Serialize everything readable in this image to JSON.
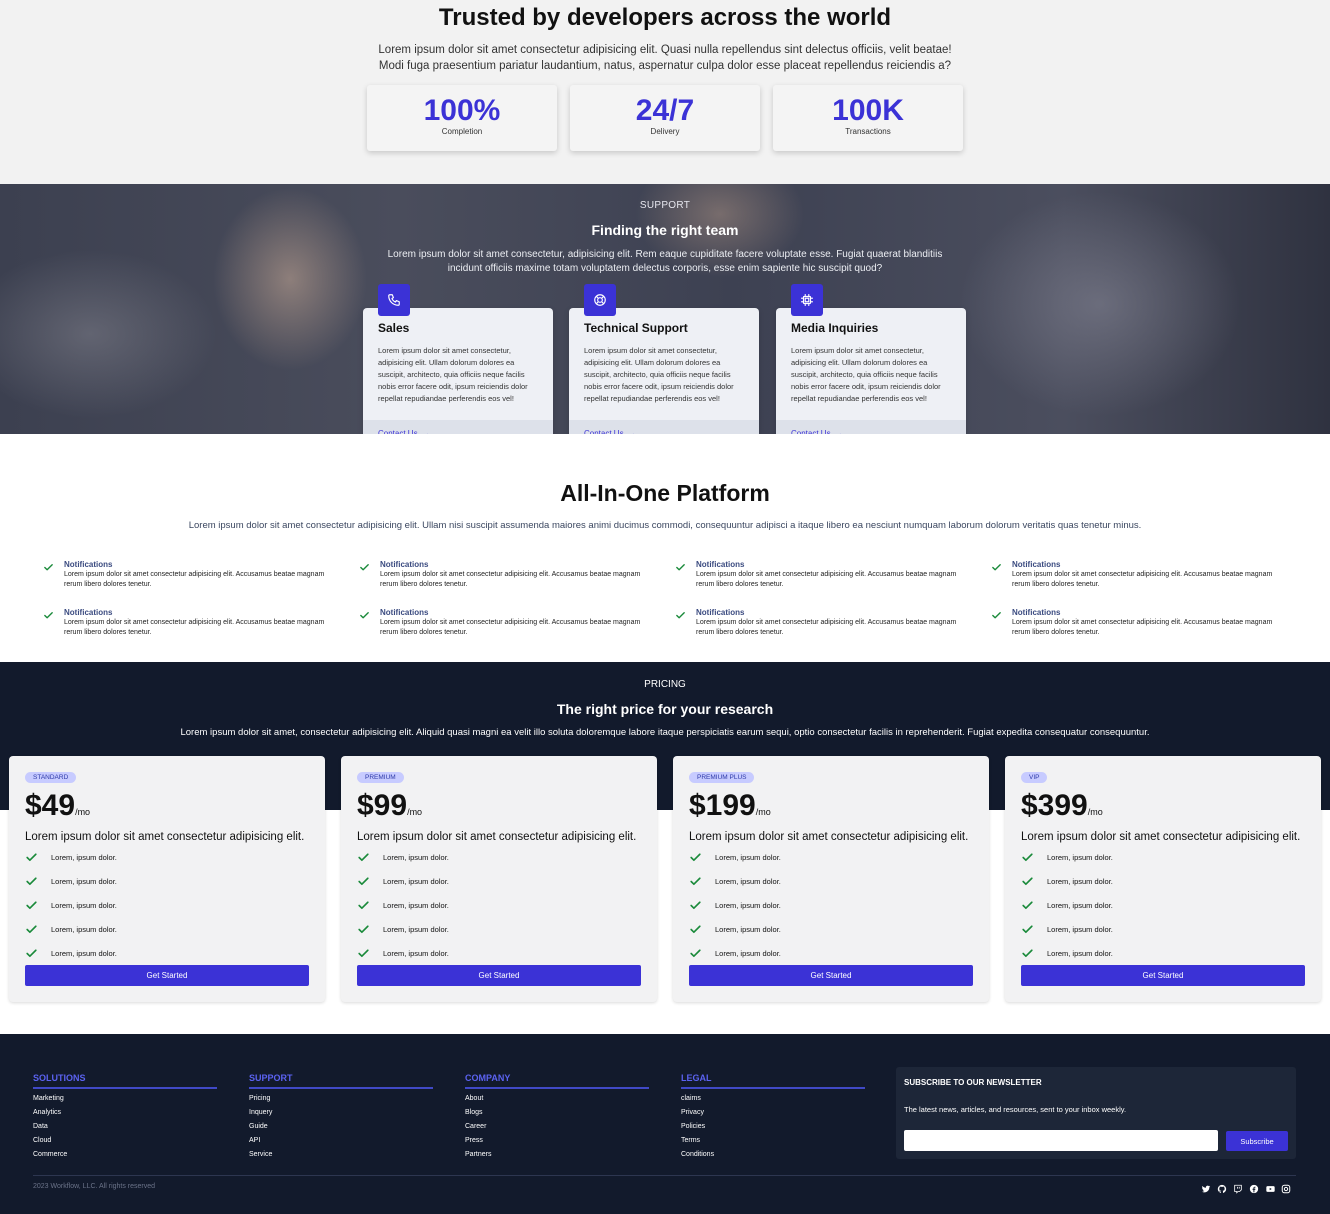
{
  "stats": {
    "title": "Trusted by developers across the world",
    "description": "Lorem ipsum dolor sit amet consectetur adipisicing elit. Quasi nulla repellendus sint delectus officiis, velit beatae! Modi fuga praesentium pariatur laudantium, natus, aspernatur culpa dolor esse placeat repellendus reiciendis a?",
    "items": [
      {
        "value": "100%",
        "label": "Completion"
      },
      {
        "value": "24/7",
        "label": "Delivery"
      },
      {
        "value": "100K",
        "label": "Transactions"
      }
    ]
  },
  "support": {
    "eyebrow": "SUPPORT",
    "title": "Finding the right team",
    "description": "Lorem ipsum dolor sit amet consectetur, adipisicing elit. Rem eaque cupiditate facere voluptate esse. Fugiat quaerat blanditiis incidunt officiis maxime totam voluptatem delectus corporis, esse enim sapiente hic suscipit quod?",
    "cards": [
      {
        "icon": "phone-icon",
        "title": "Sales",
        "text": "Lorem ipsum dolor sit amet consectetur, adipisicing elit. Ullam dolorum dolores ea suscipit, architecto, quia officiis neque facilis nobis error facere odit, ipsum reiciendis dolor repellat repudiandae perferendis eos vel!",
        "link": "Contact Us"
      },
      {
        "icon": "support-icon",
        "title": "Technical Support",
        "text": "Lorem ipsum dolor sit amet consectetur, adipisicing elit. Ullam dolorum dolores ea suscipit, architecto, quia officiis neque facilis nobis error facere odit, ipsum reiciendis dolor repellat repudiandae perferendis eos vel!",
        "link": "Contact Us"
      },
      {
        "icon": "chip-icon",
        "title": "Media Inquiries",
        "text": "Lorem ipsum dolor sit amet consectetur, adipisicing elit. Ullam dolorum dolores ea suscipit, architecto, quia officiis neque facilis nobis error facere odit, ipsum reiciendis dolor repellat repudiandae perferendis eos vel!",
        "link": "Contact Us"
      }
    ]
  },
  "platform": {
    "title": "All-In-One Platform",
    "description": "Lorem ipsum dolor sit amet consectetur adipisicing elit. Ullam nisi suscipit assumenda maiores animi ducimus commodi, consequuntur adipisci a itaque libero ea nesciunt numquam laborum dolorum veritatis quas tenetur minus.",
    "features": [
      {
        "title": "Notifications",
        "text": "Lorem ipsum dolor sit amet consectetur adipisicing elit. Accusamus beatae magnam rerum libero dolores tenetur."
      },
      {
        "title": "Notifications",
        "text": "Lorem ipsum dolor sit amet consectetur adipisicing elit. Accusamus beatae magnam rerum libero dolores tenetur."
      },
      {
        "title": "Notifications",
        "text": "Lorem ipsum dolor sit amet consectetur adipisicing elit. Accusamus beatae magnam rerum libero dolores tenetur."
      },
      {
        "title": "Notifications",
        "text": "Lorem ipsum dolor sit amet consectetur adipisicing elit. Accusamus beatae magnam rerum libero dolores tenetur."
      },
      {
        "title": "Notifications",
        "text": "Lorem ipsum dolor sit amet consectetur adipisicing elit. Accusamus beatae magnam rerum libero dolores tenetur."
      },
      {
        "title": "Notifications",
        "text": "Lorem ipsum dolor sit amet consectetur adipisicing elit. Accusamus beatae magnam rerum libero dolores tenetur."
      },
      {
        "title": "Notifications",
        "text": "Lorem ipsum dolor sit amet consectetur adipisicing elit. Accusamus beatae magnam rerum libero dolores tenetur."
      },
      {
        "title": "Notifications",
        "text": "Lorem ipsum dolor sit amet consectetur adipisicing elit. Accusamus beatae magnam rerum libero dolores tenetur."
      }
    ]
  },
  "pricing": {
    "eyebrow": "PRICING",
    "title": "The right price for your research",
    "description": "Lorem ipsum dolor sit amet, consectetur adipisicing elit. Aliquid quasi magni ea velit illo soluta doloremque labore itaque perspiciatis earum sequi, optio consectetur facilis in reprehenderit. Fugiat expedita consequatur consequuntur.",
    "plans": [
      {
        "badge": "STANDARD",
        "price": "$49",
        "per": "/mo",
        "desc": "Lorem ipsum dolor sit amet consectetur adipisicing elit.",
        "features": [
          "Lorem, ipsum dolor.",
          "Lorem, ipsum dolor.",
          "Lorem, ipsum dolor.",
          "Lorem, ipsum dolor.",
          "Lorem, ipsum dolor."
        ],
        "cta": "Get Started"
      },
      {
        "badge": "PREMIUM",
        "price": "$99",
        "per": "/mo",
        "desc": "Lorem ipsum dolor sit amet consectetur adipisicing elit.",
        "features": [
          "Lorem, ipsum dolor.",
          "Lorem, ipsum dolor.",
          "Lorem, ipsum dolor.",
          "Lorem, ipsum dolor.",
          "Lorem, ipsum dolor."
        ],
        "cta": "Get Started"
      },
      {
        "badge": "PREMIUM PLUS",
        "price": "$199",
        "per": "/mo",
        "desc": "Lorem ipsum dolor sit amet consectetur adipisicing elit.",
        "features": [
          "Lorem, ipsum dolor.",
          "Lorem, ipsum dolor.",
          "Lorem, ipsum dolor.",
          "Lorem, ipsum dolor.",
          "Lorem, ipsum dolor."
        ],
        "cta": "Get Started"
      },
      {
        "badge": "VIP",
        "price": "$399",
        "per": "/mo",
        "desc": "Lorem ipsum dolor sit amet consectetur adipisicing elit.",
        "features": [
          "Lorem, ipsum dolor.",
          "Lorem, ipsum dolor.",
          "Lorem, ipsum dolor.",
          "Lorem, ipsum dolor.",
          "Lorem, ipsum dolor."
        ],
        "cta": "Get Started"
      }
    ]
  },
  "footer": {
    "columns": [
      {
        "title": "SOLUTIONS",
        "links": [
          "Marketing",
          "Analytics",
          "Data",
          "Cloud",
          "Commerce"
        ]
      },
      {
        "title": "SUPPORT",
        "links": [
          "Pricing",
          "Inquery",
          "Guide",
          "API",
          "Service"
        ]
      },
      {
        "title": "COMPANY",
        "links": [
          "About",
          "Blogs",
          "Career",
          "Press",
          "Partners"
        ]
      },
      {
        "title": "LEGAL",
        "links": [
          "claims",
          "Privacy",
          "Policies",
          "Terms",
          "Conditions"
        ]
      }
    ],
    "newsletter": {
      "title": "SUBSCRIBE TO OUR NEWSLETTER",
      "text": "The latest news, articles, and resources, sent to your inbox weekly.",
      "placeholder": "",
      "button": "Subscribe"
    },
    "copyright": "2023 Workflow, LLC. All rights reserved",
    "socials": [
      "twitter-icon",
      "github-icon",
      "twitch-icon",
      "facebook-icon",
      "youtube-icon",
      "instagram-icon"
    ]
  },
  "colors": {
    "accent": "#3b32d6",
    "dark": "#121a2c",
    "check": "#1a8a3a"
  }
}
